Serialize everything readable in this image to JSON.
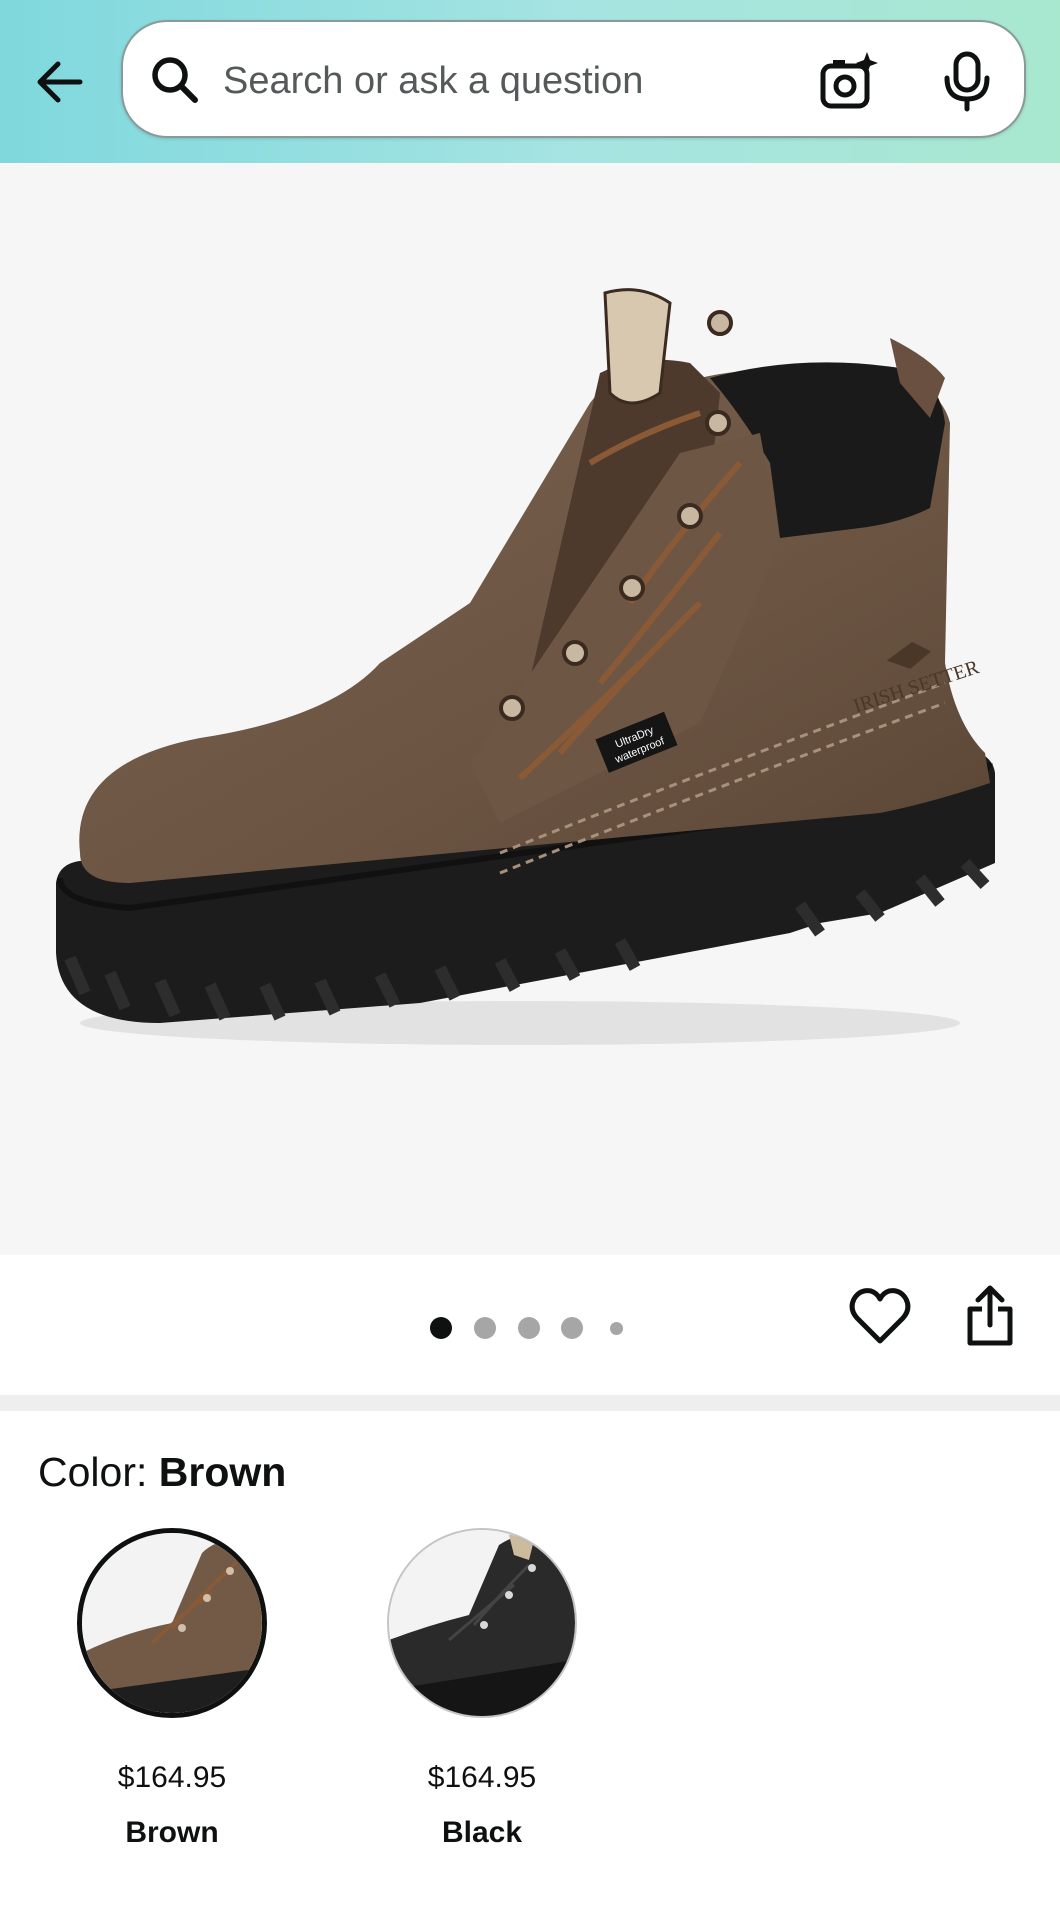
{
  "header": {
    "search_placeholder": "Search or ask a question",
    "icons": [
      "back-arrow-icon",
      "search-icon",
      "camera-sparkle-icon",
      "microphone-icon"
    ]
  },
  "gallery": {
    "image_count": 5,
    "active_index": 0,
    "actions": [
      "heart-icon",
      "share-icon"
    ]
  },
  "variation": {
    "label": "Color:",
    "selected_value": "Brown",
    "options": [
      {
        "price": "$164.95",
        "name": "Brown",
        "selected": true
      },
      {
        "price": "$164.95",
        "name": "Black",
        "selected": false
      }
    ]
  },
  "product": {
    "boot_tag_text": "UltraDry waterproof",
    "brand_stamp": "IRISH SETTER"
  },
  "colors": {
    "header_gradient_start": "#7fd8dd",
    "header_gradient_end": "#a8e8cf",
    "active_dot": "#0f1111",
    "inactive_dot": "#a6a6a6"
  }
}
